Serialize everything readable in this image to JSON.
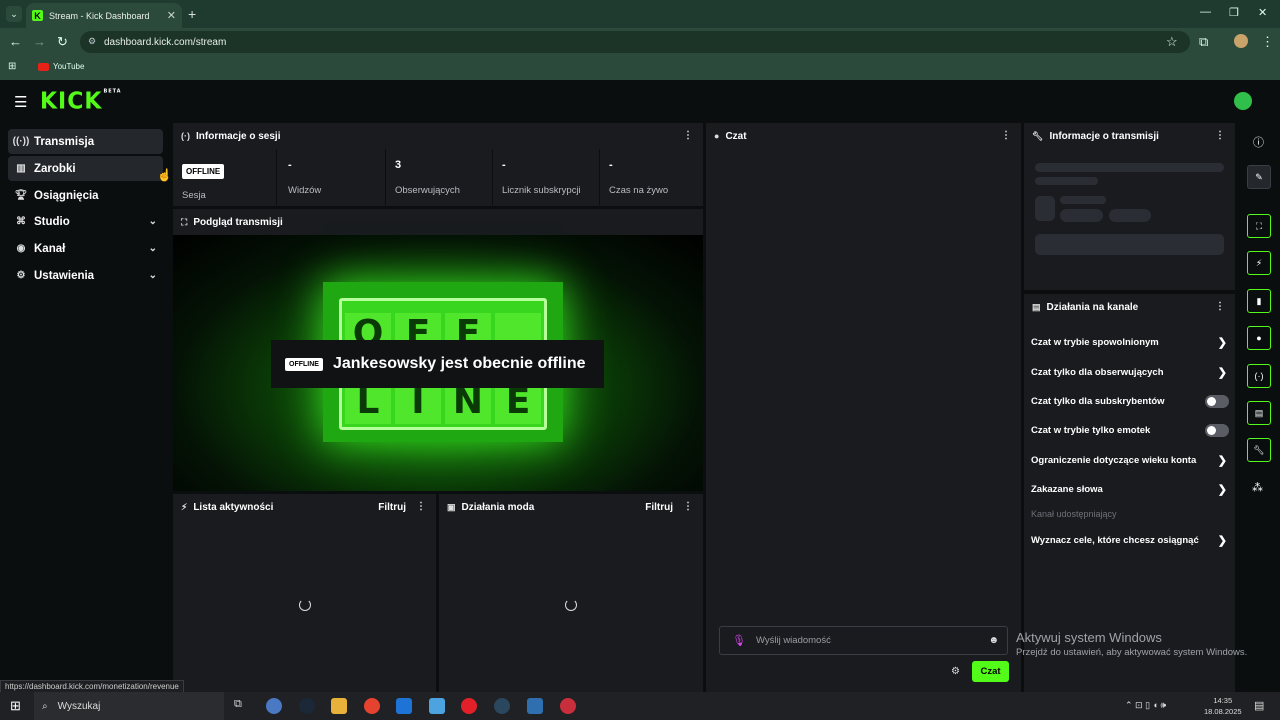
{
  "browser": {
    "tab_title": "Stream - Kick Dashboard",
    "tab_close": "✕",
    "new_tab": "+",
    "url": "dashboard.kick.com/stream",
    "bookmark": "YouTube",
    "status_url": "https://dashboard.kick.com/monetization/revenue"
  },
  "app": {
    "logo": "KICK",
    "logo_badge": "BETA"
  },
  "sidebar": {
    "items": [
      {
        "label": "Transmisja"
      },
      {
        "label": "Zarobki"
      },
      {
        "label": "Osiągnięcia"
      },
      {
        "label": "Studio"
      },
      {
        "label": "Kanał"
      },
      {
        "label": "Ustawienia"
      }
    ]
  },
  "session": {
    "title": "Informacje o sesji",
    "badge": "OFFLINE",
    "stats": [
      {
        "value": "",
        "label": "Sesja"
      },
      {
        "value": "-",
        "label": "Widzów"
      },
      {
        "value": "3",
        "label": "Obserwujących"
      },
      {
        "value": "-",
        "label": "Licznik subskrypcji"
      },
      {
        "value": "-",
        "label": "Czas na żywo"
      }
    ]
  },
  "preview": {
    "title": "Podgląd transmisji",
    "badge": "OFFLINE",
    "message": "Jankesowsky jest obecnie offline",
    "off_letters": [
      "O",
      "F",
      "F"
    ],
    "line_letters": [
      "L",
      "I",
      "N",
      "E"
    ]
  },
  "activity": {
    "title": "Lista aktywności",
    "filter": "Filtruj"
  },
  "mod": {
    "title": "Działania moda",
    "filter": "Filtruj"
  },
  "chat": {
    "title": "Czat",
    "placeholder": "Wyślij wiadomość",
    "send": "Czat"
  },
  "stream_info": {
    "title": "Informacje o transmisji"
  },
  "channel_actions": {
    "title": "Działania na kanale",
    "rows": [
      {
        "label": "Czat w trybie spowolnionym",
        "type": "chevron"
      },
      {
        "label": "Czat tylko dla obserwujących",
        "type": "chevron"
      },
      {
        "label": "Czat tylko dla subskrybentów",
        "type": "toggle"
      },
      {
        "label": "Czat w trybie tylko emotek",
        "type": "toggle"
      },
      {
        "label": "Ograniczenie dotyczące wieku konta",
        "type": "chevron"
      },
      {
        "label": "Zakazane słowa",
        "type": "chevron"
      }
    ],
    "muted_label": "Kanał udostępniający",
    "goal_label": "Wyznacz cele, które chcesz osiągnąć"
  },
  "taskbar": {
    "search": "Wyszukaj",
    "time": "14:35",
    "date": "18.08.2025"
  },
  "watermark": {
    "line1": "Aktywuj system Windows",
    "line2": "Przejdź do ustawień, aby aktywować system Windows."
  }
}
